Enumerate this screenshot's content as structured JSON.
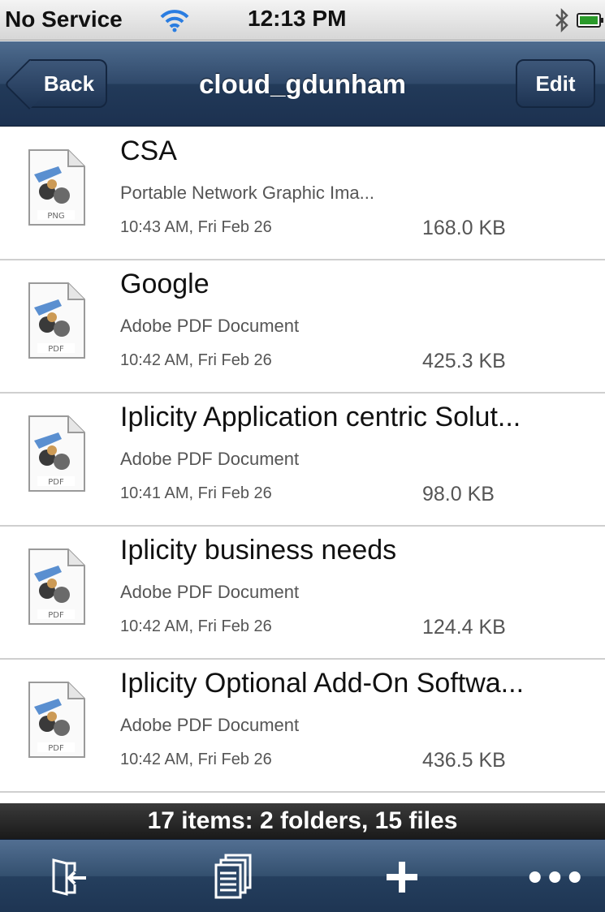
{
  "status": {
    "carrier": "No Service",
    "time": "12:13 PM",
    "icons": [
      "wifi-icon",
      "bluetooth-icon",
      "battery-icon"
    ]
  },
  "nav": {
    "title": "cloud_gdunham",
    "back_label": "Back",
    "edit_label": "Edit"
  },
  "files": [
    {
      "name": "CSA",
      "type": "Portable Network Graphic Ima...",
      "date": "10:43 AM, Fri Feb 26",
      "size": "168.0 KB",
      "badge": "PNG"
    },
    {
      "name": "Google",
      "type": "Adobe PDF Document",
      "date": "10:42 AM, Fri Feb 26",
      "size": "425.3 KB",
      "badge": "PDF"
    },
    {
      "name": "Iplicity Application centric Solut...",
      "type": "Adobe PDF Document",
      "date": "10:41 AM, Fri Feb 26",
      "size": "98.0 KB",
      "badge": "PDF"
    },
    {
      "name": "Iplicity business needs",
      "type": "Adobe PDF Document",
      "date": "10:42 AM, Fri Feb 26",
      "size": "124.4 KB",
      "badge": "PDF"
    },
    {
      "name": "Iplicity Optional Add-On Softwa...",
      "type": "Adobe PDF Document",
      "date": "10:42 AM, Fri Feb 26",
      "size": "436.5 KB",
      "badge": "PDF"
    }
  ],
  "summary": "17 items:  2 folders,  15 files",
  "toolbar": {
    "items": [
      "exit-icon",
      "copy-icon",
      "add-icon",
      "more-icon"
    ]
  },
  "colors": {
    "nav": "#2b4466",
    "summary": "#222222",
    "toolbar": "#2b4466"
  }
}
